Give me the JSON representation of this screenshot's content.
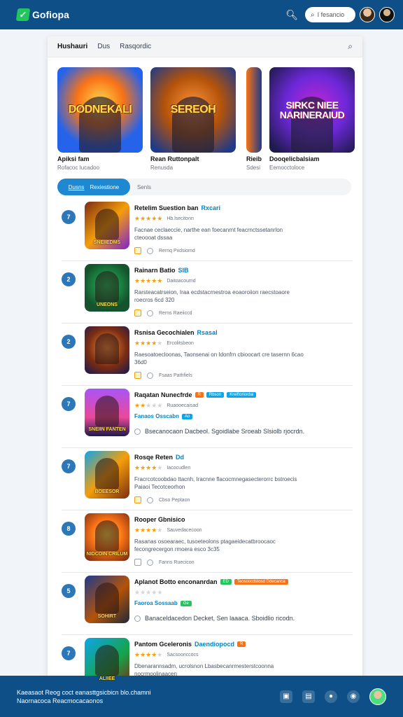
{
  "header": {
    "logo_text": "Gofiopa",
    "search_value": "I fesancio"
  },
  "card_header": {
    "title": "Hushauri",
    "link1": "Dus",
    "link2": "Rasqordic"
  },
  "featured": [
    {
      "art_text": "DODNEKALI",
      "title": "Apiksi fam",
      "subtitle": "Rofacoc Iucadoo"
    },
    {
      "art_text": "SEREOH",
      "title": "Rean Ruttonpalt",
      "subtitle": "Renusda"
    },
    {
      "art_text": "",
      "title": "Rieib",
      "subtitle": "Sdesi"
    },
    {
      "art_text": "SIRKC NIEE NARINERAIUD",
      "title": "Dooqelicbalsiam",
      "subtitle": "Eemocctoloce"
    }
  ],
  "tabs": {
    "active_part1": "Dusns",
    "active_part2": "Rexiestione",
    "other": "Senls"
  },
  "list": [
    {
      "num": "7",
      "thumb": "SNEIIEDMS",
      "title": "Retelim Suestion ban",
      "tag_text": "Rxcari",
      "badges": [],
      "stars": 5,
      "rating_text": "Hb.lsecitonn",
      "desc": "Facnae ceclaeccie, narthe ean foecanrnt feacrnctssetanrlon cteoooat dssaa",
      "meta_icon": "orange",
      "meta": "Rernq Pxdsiomd",
      "promo": "",
      "wide": ""
    },
    {
      "num": "2",
      "thumb": "UNEONS",
      "title": "Rainarn Batio",
      "tag_text": "SIB",
      "badges": [],
      "stars": 5,
      "rating_text": "Daitoacoumd",
      "desc": "Rarsteacatrseion, Iraa ecdstacrnestroa eoaoroiion raecstoaore roecros 6cd 320",
      "meta_icon": "orange",
      "meta": "Rerns Raeiiccd",
      "promo": "",
      "wide": ""
    },
    {
      "num": "2",
      "thumb": "",
      "title": "Rsnisa Gecochialen",
      "tag_text": "Rsasal",
      "badges": [],
      "stars": 4,
      "rating_text": "Ercolitsbeon",
      "desc": "Raesoatoecloonas, Taonsenai on Idonfrn cbioocart cre tasernn 6cao 36d0",
      "meta_icon": "orange",
      "meta": "Fsaas Pathfiels",
      "promo": "",
      "wide": ""
    },
    {
      "num": "7",
      "thumb": "SNEIIN FANTEN",
      "title": "Raqatan Nunecfrde",
      "tag_text": "",
      "badges": [
        {
          "color": "orange",
          "text": "R"
        },
        {
          "color": "blue",
          "text": "Rbson"
        },
        {
          "color": "blue",
          "text": "Kreiftoriordai"
        }
      ],
      "stars": 2,
      "rating_text": "Ruaooecaisad",
      "desc": "",
      "meta_icon": "",
      "meta": "",
      "promo": "Fanaos Osscabn",
      "promo_badge": "Ao",
      "wide": "Bsecanocaon Dacbeol. Sgoidlabe Sroeab Slsiolb rjocrdn."
    },
    {
      "num": "7",
      "thumb": "BOEESOR",
      "title": "Rosqe Reten",
      "tag_text": "Dd",
      "badges": [],
      "stars": 4,
      "rating_text": "Iacocudlen",
      "desc": "Fracrcotcoobdao ttacnh, Iracnne flacocmnegasecterorrc bstroecis Paiaoi Tecotceorhon",
      "meta_icon": "orange",
      "meta": "Cbso Peptaon",
      "promo": "",
      "wide": ""
    },
    {
      "num": "8",
      "thumb": "NIDCOIN CRILUM",
      "title": "Rooper Gbnisico",
      "tag_text": "",
      "badges": [],
      "stars": 4,
      "rating_text": "Sauvedacecoon",
      "desc": "Rasanas osoearaec, tusoeteolons ptagaeidecatbroocaoc fecongrecergon rmoera esco 3c35",
      "meta_icon": "grey",
      "meta": "Fanns Ruecicon",
      "promo": "",
      "wide": ""
    },
    {
      "num": "5",
      "thumb": "SOHIRT",
      "title": "Aplanot Botto enconanrdan",
      "tag_text": "",
      "badges": [
        {
          "color": "green",
          "text": "ED"
        },
        {
          "color": "orange",
          "text": "Teosoocdstosd Ddecanca"
        }
      ],
      "stars": 0,
      "rating_text": "",
      "desc": "",
      "meta_icon": "",
      "meta": "",
      "promo": "Faoroa Sossaab",
      "promo_badge": "Ge",
      "wide": "Banaceldacedon Decket, Sen laaaca. Sboidlio ricodn."
    },
    {
      "num": "7",
      "thumb": "ALIIEE",
      "title": "Pantom Gceleronis",
      "tag_text": "Daendiopocd",
      "badges": [
        {
          "color": "orange",
          "text": "R"
        }
      ],
      "stars": 4,
      "rating_text": "Sacsoonccocs",
      "desc": "Dbenarannsadm, ucrolsnon Lbasbecanrmesterstcoonna nocrmoolinaacen",
      "meta_icon": "orange",
      "meta": "",
      "promo": "",
      "wide": ""
    }
  ],
  "bottombar": {
    "line1": "Kaeasaot Reog coct eanasttgsicbicn blo.chamni",
    "line2": "Naornacoca Reacmocacaonos"
  }
}
